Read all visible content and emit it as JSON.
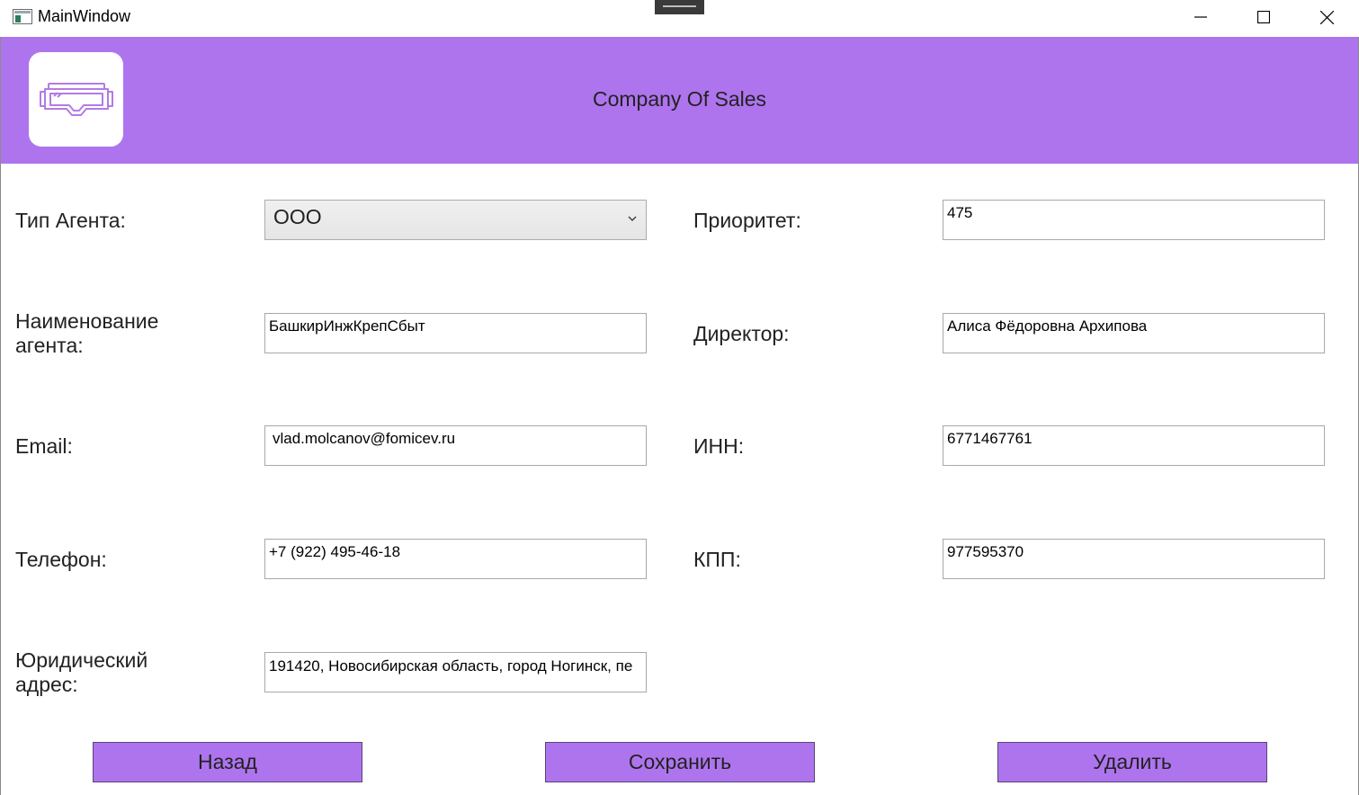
{
  "window": {
    "title": "MainWindow"
  },
  "header": {
    "company": "Company Of Sales",
    "logo_icon": "vr-goggles-icon",
    "background": "#ae74ee"
  },
  "form": {
    "agent_type": {
      "label": "Тип Агента:",
      "value": "ООО"
    },
    "agent_name": {
      "label": "Наименование агента:",
      "value": "БашкирИнжКрепСбыт"
    },
    "email": {
      "label": "Email:",
      "value": "vlad.molcanov@fomicev.ru"
    },
    "phone": {
      "label": "Телефон:",
      "value": "+7 (922) 495-46-18"
    },
    "legal_address": {
      "label": "Юридический адрес:",
      "value": "191420, Новосибирская область, город Ногинск, пе"
    },
    "priority": {
      "label": "Приоритет:",
      "value": "475"
    },
    "director": {
      "label": "Директор:",
      "value": "Алиса Фёдоровна Архипова"
    },
    "inn": {
      "label": "ИНН:",
      "value": "6771467761"
    },
    "kpp": {
      "label": "КПП:",
      "value": "977595370"
    }
  },
  "buttons": {
    "back": "Назад",
    "save": "Сохранить",
    "delete": "Удалить"
  }
}
